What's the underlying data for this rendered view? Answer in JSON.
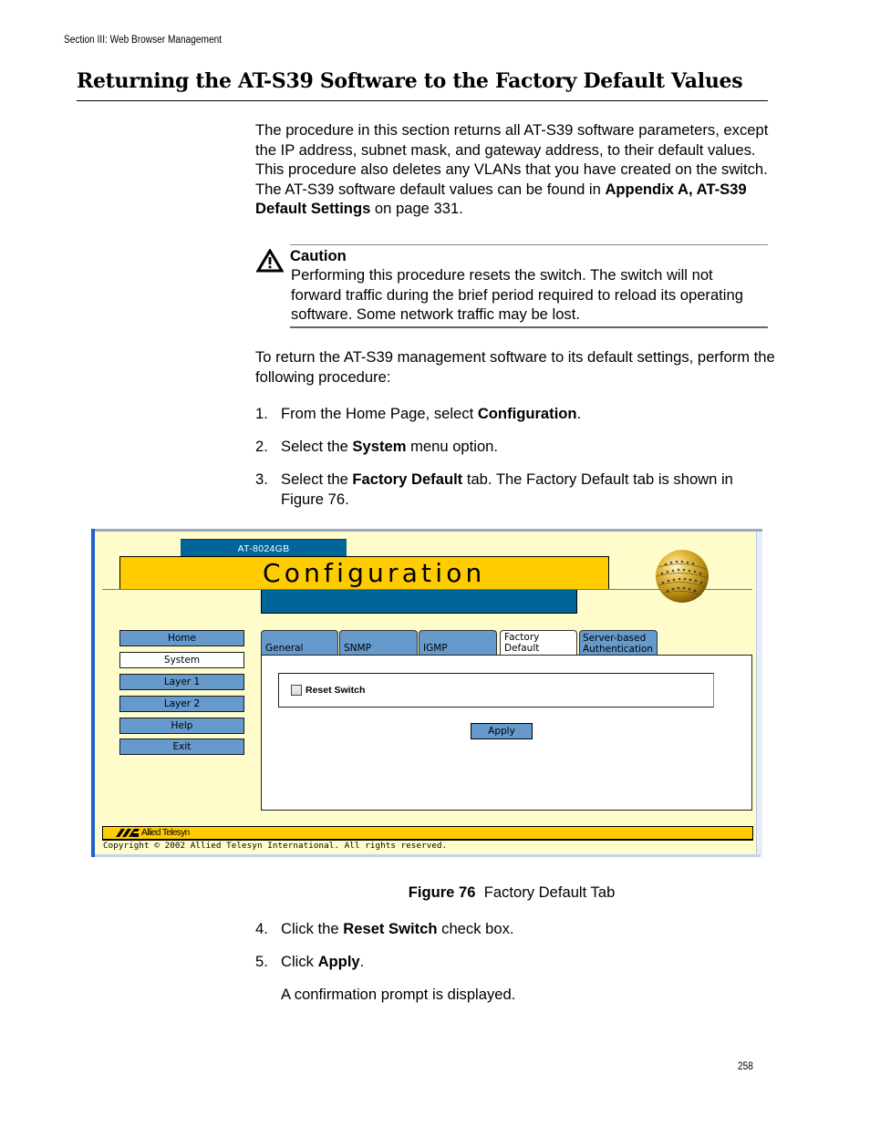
{
  "header": {
    "running_head": "Section III: Web Browser Management",
    "title": "Returning the AT-S39 Software to the Factory Default Values"
  },
  "intro": {
    "text_before": "The procedure in this section returns all AT-S39 software parameters, except the IP address, subnet mask, and gateway address, to their default values. This procedure also deletes any VLANs that you have created on the switch. The AT-S39 software default values can be found in ",
    "link_bold": "Appendix A, AT-S39 Default Settings",
    "text_after": " on page 331."
  },
  "caution": {
    "icon": "warning-triangle-icon",
    "title": "Caution",
    "text": "Performing this procedure resets the switch. The switch will not forward traffic during the brief period required to reload its operating software. Some network traffic may be lost."
  },
  "procedure_intro": "To return the AT-S39 management software to its default settings, perform the following procedure:",
  "steps": [
    {
      "num": "1.",
      "before": "From the Home Page, select ",
      "bold": "Configuration",
      "after": "."
    },
    {
      "num": "2.",
      "before": "Select the ",
      "bold": "System",
      "after": " menu option."
    },
    {
      "num": "3.",
      "before": "Select the ",
      "bold": "Factory Default",
      "after": " tab. The Factory Default tab is shown in Figure 76."
    },
    {
      "num": "4.",
      "before": "Click the ",
      "bold": "Reset Switch",
      "after": " check box."
    },
    {
      "num": "5.",
      "before": "Click ",
      "bold": "Apply",
      "after": "."
    }
  ],
  "step5_note": "A confirmation prompt is displayed.",
  "figure": {
    "model": "AT-8024GB",
    "banner_title": "Configuration",
    "logo_icon": "globe-icon",
    "nav": [
      {
        "label": "Home",
        "active": false
      },
      {
        "label": "System",
        "active": true
      },
      {
        "label": "Layer 1",
        "active": false
      },
      {
        "label": "Layer 2",
        "active": false
      },
      {
        "label": "Help",
        "active": false
      },
      {
        "label": "Exit",
        "active": false
      }
    ],
    "tabs": [
      {
        "label": "General",
        "active": false
      },
      {
        "label": "SNMP",
        "active": false
      },
      {
        "label": "IGMP",
        "active": false
      },
      {
        "label_line1": "Factory",
        "label_line2": "Default",
        "active": true
      },
      {
        "label_line1": "Server-based",
        "label_line2": "Authentication",
        "active": false
      }
    ],
    "checkbox_label": "Reset Switch",
    "checkbox_checked": false,
    "apply_label": "Apply",
    "footer_brand": "Allied Telesyn",
    "copyright": "Copyright © 2002 Allied Telesyn International. All rights reserved.",
    "colors": {
      "background": "#fffccc",
      "accent_yellow": "#ffcc00",
      "accent_blue": "#006699",
      "button_blue": "#6699cc"
    }
  },
  "caption": {
    "label": "Figure 76",
    "text": "Factory Default Tab"
  },
  "page_number": "258"
}
